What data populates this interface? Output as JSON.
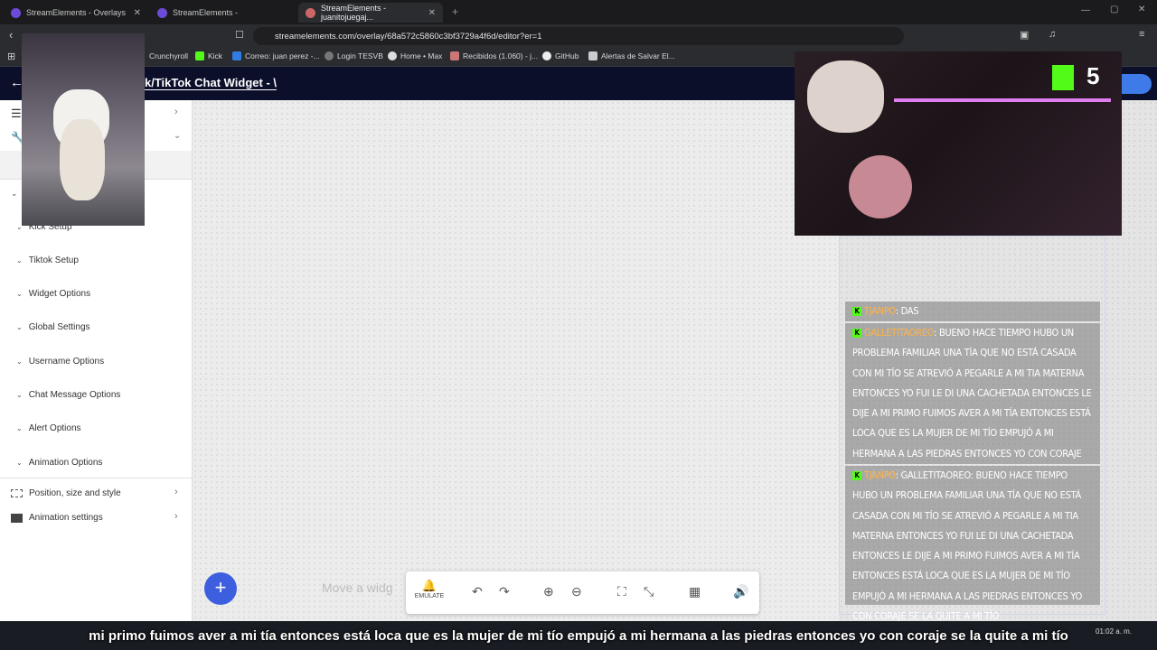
{
  "tabs": [
    {
      "label": "StreamElements - Overlays"
    },
    {
      "label": "StreamElements -"
    },
    {
      "label": "StreamElements - juanitojuegaj..."
    }
  ],
  "url": "streamelements.com/overlay/68a572c5860c3bf3729a4f6d/editor?er=1",
  "bookmarks": [
    "Crunchyroll",
    "Kick",
    "Correo: juan perez -...",
    "Login TESVB",
    "Home • Max",
    "Recibidos (1.060) - j...",
    "GitHub",
    "Alertas de Salvar El..."
  ],
  "editor": {
    "title": "k/TikTok Chat Widget - \\"
  },
  "sidebar": {
    "sections": [
      "Kick Setup",
      "Tiktok Setup",
      "Widget Options",
      "Global Settings",
      "Username Options",
      "Chat Message Options",
      "Alert Options",
      "Animation Options"
    ],
    "panel_position": "Position, size and style",
    "panel_animation": "Animation settings"
  },
  "overlay": {
    "kick_count": "5"
  },
  "chat": [
    {
      "user": "TJANPO",
      "text": "DAS"
    },
    {
      "user": "GALLETITAOREO",
      "text": "BUENO HACE TIEMPO HUBO UN PROBLEMA FAMILIAR UNA TÍA QUE NO ESTÁ CASADA CON MI TÍO SE ATREVIÓ A PEGARLE A MI TIA MATERNA ENTONCES YO FUI LE DI UNA CACHETADA ENTONCES LE DIJE A MI PRIMO FUIMOS AVER A MI TÍA ENTONCES ESTÁ LOCA QUE ES LA MUJER DE MI TÍO EMPUJÓ A MI HERMANA A LAS PIEDRAS ENTONCES YO CON CORAJE SE LA QUITE A MI TÍO"
    },
    {
      "user": "TJANPO",
      "text": "GALLETITAOREO: BUENO HACE TIEMPO HUBO UN PROBLEMA FAMILIAR UNA TÍA QUE NO ESTÁ CASADA CON MI TÍO SE ATREVIÓ A PEGARLE A MI TIA MATERNA ENTONCES YO FUI LE DI UNA CACHETADA ENTONCES LE DIJE A MI PRIMO FUIMOS AVER A MI TÍA ENTONCES ESTÁ LOCA QUE ES LA MUJER DE MI TÍO EMPUJÓ A MI HERMANA A LAS PIEDRAS ENTONCES YO CON CORAJE SE LA QUITE A MI TÍO"
    }
  ],
  "toolbar": {
    "emulate_label": "EMULATE"
  },
  "canvas": {
    "hint": "Move a widg"
  },
  "caption": "mi primo fuimos aver a mi tía entonces está loca que es la mujer de mi tío empujó a mi hermana a las piedras entonces yo con coraje se la quite a mi tío",
  "clock": "01:02 a. m."
}
